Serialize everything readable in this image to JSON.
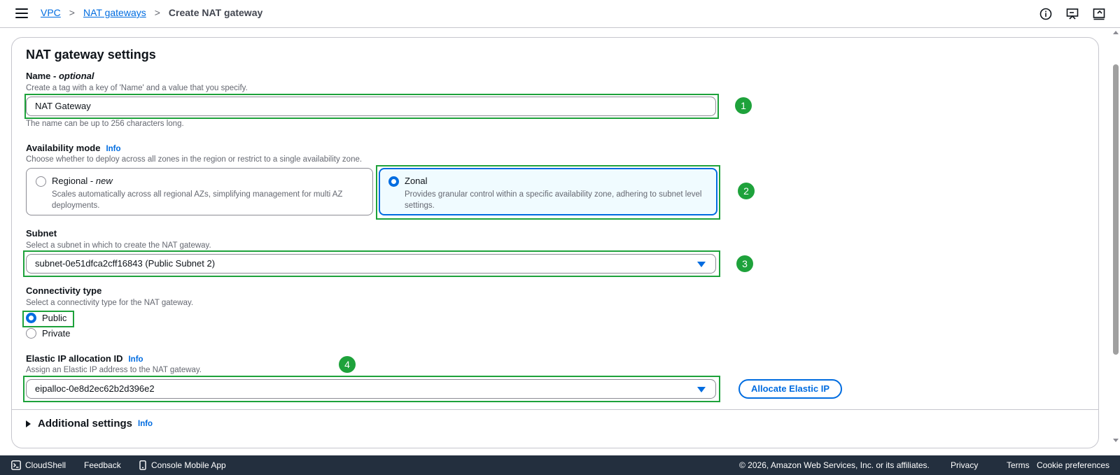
{
  "breadcrumb": {
    "vpc": "VPC",
    "nat_gateways": "NAT gateways",
    "current": "Create NAT gateway"
  },
  "panel": {
    "title": "NAT gateway settings"
  },
  "name_field": {
    "label": "Name - ",
    "label_optional": "optional",
    "description": "Create a tag with a key of 'Name' and a value that you specify.",
    "value": "NAT Gateway",
    "hint": "The name can be up to 256 characters long."
  },
  "availability": {
    "label": "Availability mode",
    "info": "Info",
    "description": "Choose whether to deploy across all zones in the region or restrict to a single availability zone.",
    "regional_title": "Regional - ",
    "regional_new": "new",
    "regional_desc": "Scales automatically across all regional AZs, simplifying management for multi AZ deployments.",
    "zonal_title": "Zonal",
    "zonal_desc": "Provides granular control within a specific availability zone, adhering to subnet level settings.",
    "selected": "Zonal"
  },
  "subnet": {
    "label": "Subnet",
    "description": "Select a subnet in which to create the NAT gateway.",
    "value": "subnet-0e51dfca2cff16843 (Public Subnet 2)"
  },
  "connectivity": {
    "label": "Connectivity type",
    "description": "Select a connectivity type for the NAT gateway.",
    "options": [
      "Public",
      "Private"
    ],
    "selected": "Public"
  },
  "elastic_ip": {
    "label": "Elastic IP allocation ID",
    "info": "Info",
    "description": "Assign an Elastic IP address to the NAT gateway.",
    "value": "eipalloc-0e8d2ec62b2d396e2",
    "allocate_button": "Allocate Elastic IP"
  },
  "additional": {
    "label": "Additional settings",
    "info": "Info"
  },
  "badges": [
    "1",
    "2",
    "3",
    "4"
  ],
  "footer": {
    "cloudshell": "CloudShell",
    "feedback": "Feedback",
    "mobile_app": "Console Mobile App",
    "copyright": "© 2026, Amazon Web Services, Inc. or its affiliates.",
    "privacy": "Privacy",
    "terms": "Terms",
    "cookies": "Cookie preferences"
  },
  "colors": {
    "accent": "#006ce0",
    "annotation_green": "#1ea23b",
    "footer_bg": "#232f3e"
  }
}
